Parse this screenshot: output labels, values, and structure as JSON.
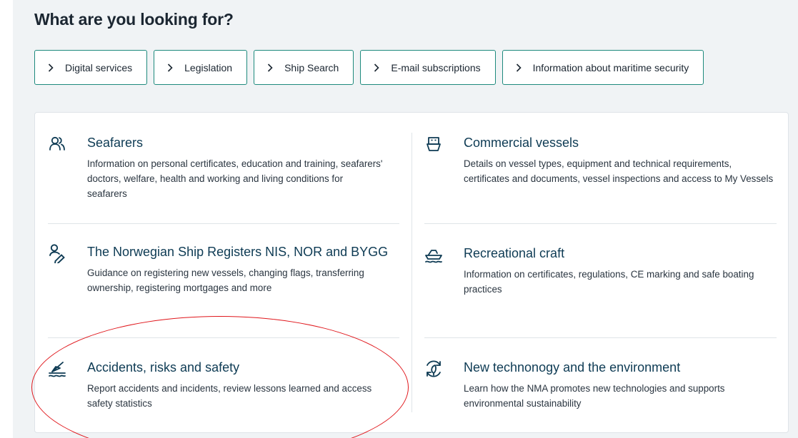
{
  "heading": "What are you looking for?",
  "quick_links": [
    {
      "label": "Digital services"
    },
    {
      "label": "Legislation"
    },
    {
      "label": "Ship Search"
    },
    {
      "label": "E-mail subscriptions"
    },
    {
      "label": "Information about maritime security"
    }
  ],
  "topics": {
    "seafarers": {
      "icon": "people-icon",
      "title": "Seafarers",
      "description": "Information on personal certificates, education and training, seafarers' doctors, welfare, health and working and living conditions for seafarers"
    },
    "commercial_vessels": {
      "icon": "vessel-icon",
      "title": "Commercial vessels",
      "description": "Details on vessel types, equipment and technical requirements, certificates and documents, vessel inspections and access to My Vessels"
    },
    "ship_registers": {
      "icon": "person-register-icon",
      "title": "The Norwegian Ship Registers NIS, NOR and BYGG",
      "description": "Guidance on registering new vessels, changing flags, transferring ownership, registering mortgages and more"
    },
    "recreational_craft": {
      "icon": "boat-icon",
      "title": "Recreational craft",
      "description": "Information on certificates, regulations, CE marking and safe boating practices"
    },
    "accidents": {
      "icon": "safety-icon",
      "title": "Accidents, risks and safety",
      "description": "Report accidents and incidents, review lessons learned and access safety statistics"
    },
    "technology": {
      "icon": "eco-technology-icon",
      "title": "New technonogy and the environment",
      "description": "Learn how the NMA promotes new technologies and supports environmental sustainability"
    }
  },
  "colors": {
    "accent_border": "#1e8a7d",
    "title_text": "#0e3b54",
    "background": "#f0f3f5",
    "annotation": "#e0161b"
  }
}
